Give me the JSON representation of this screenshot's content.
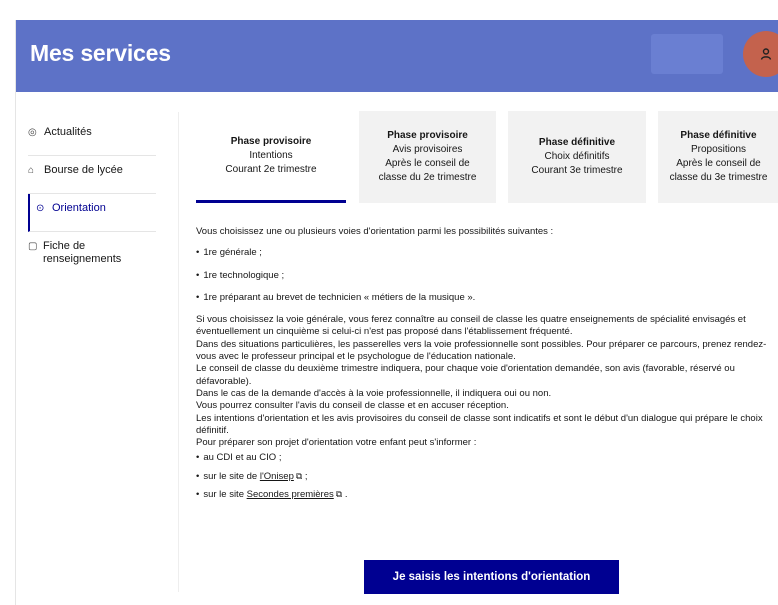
{
  "header": {
    "title": "Mes services"
  },
  "sidebar": {
    "items": [
      {
        "label": "Actualités",
        "icon": "bell-icon"
      },
      {
        "label": "Bourse de lycée",
        "icon": "bank-icon"
      },
      {
        "label": "Orientation",
        "icon": "compass-icon"
      },
      {
        "label": "Fiche de renseignements",
        "icon": "file-icon"
      }
    ]
  },
  "tabs": [
    {
      "title": "Phase provisoire",
      "lines": [
        "Intentions",
        "Courant 2e trimestre"
      ]
    },
    {
      "title": "Phase provisoire",
      "lines": [
        "Avis provisoires",
        "Après le conseil de",
        "classe du 2e trimestre"
      ]
    },
    {
      "title": "Phase définitive",
      "lines": [
        "Choix définitifs",
        "Courant 3e trimestre"
      ]
    },
    {
      "title": "Phase définitive",
      "lines": [
        "Propositions",
        "Après le conseil de",
        "classe du 3e trimestre"
      ]
    }
  ],
  "content": {
    "intro": "Vous choisissez une ou plusieurs voies d'orientation parmi les possibilités suivantes :",
    "options": [
      "1re générale ;",
      "1re technologique ;",
      "1re préparant au brevet de technicien « métiers de la musique »."
    ],
    "paragraphs": [
      "Si vous choisissez la voie générale, vous ferez connaître au conseil de classe les quatre enseignements de spécialité envisagés et éventuellement un cinquième si celui-ci n'est pas proposé dans l'établissement fréquenté.",
      "Dans des situations particulières, les passerelles vers la voie professionnelle sont possibles. Pour préparer ce parcours, prenez rendez-vous avec le professeur principal et le psychologue de l'éducation nationale.",
      "Le conseil de classe du deuxième trimestre indiquera, pour chaque voie d'orientation demandée, son avis (favorable, réservé ou défavorable).",
      "Dans le cas de la demande d'accès à la voie professionnelle, il indiquera oui ou non.",
      "Vous pourrez consulter l'avis du conseil de classe et en accuser réception.",
      "Les intentions d'orientation et les avis provisoires du conseil de classe sont indicatifs et sont le début d'un dialogue qui prépare le choix définitif.",
      "Pour préparer son projet d'orientation votre enfant peut s'informer :"
    ],
    "resources": {
      "cdi": "au CDI et au CIO ;",
      "onisep_prefix": "sur le site de ",
      "onisep_link": "l'Onisep",
      "onisep_suffix": " ;",
      "secondes_prefix": "sur le site ",
      "secondes_link": "Secondes premières",
      "secondes_suffix": " ."
    }
  },
  "cta": {
    "label": "Je saisis les intentions d'orientation"
  }
}
